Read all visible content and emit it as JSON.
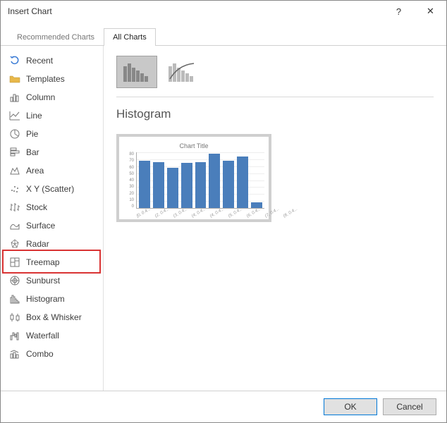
{
  "window": {
    "title": "Insert Chart",
    "help_label": "?",
    "close_label": "✕"
  },
  "tabs": [
    {
      "label": "Recommended Charts",
      "active": false
    },
    {
      "label": "All Charts",
      "active": true
    }
  ],
  "sidebar": {
    "items": [
      {
        "label": "Recent",
        "icon": "undo-icon"
      },
      {
        "label": "Templates",
        "icon": "folder-icon"
      },
      {
        "label": "Column",
        "icon": "column-icon"
      },
      {
        "label": "Line",
        "icon": "line-icon"
      },
      {
        "label": "Pie",
        "icon": "pie-icon"
      },
      {
        "label": "Bar",
        "icon": "bar-icon"
      },
      {
        "label": "Area",
        "icon": "area-icon"
      },
      {
        "label": "X Y (Scatter)",
        "icon": "scatter-icon"
      },
      {
        "label": "Stock",
        "icon": "stock-icon"
      },
      {
        "label": "Surface",
        "icon": "surface-icon"
      },
      {
        "label": "Radar",
        "icon": "radar-icon"
      },
      {
        "label": "Treemap",
        "icon": "treemap-icon"
      },
      {
        "label": "Sunburst",
        "icon": "sunburst-icon"
      },
      {
        "label": "Histogram",
        "icon": "histogram-icon"
      },
      {
        "label": "Box & Whisker",
        "icon": "boxwhisker-icon"
      },
      {
        "label": "Waterfall",
        "icon": "waterfall-icon"
      },
      {
        "label": "Combo",
        "icon": "combo-icon"
      }
    ],
    "selected": "Histogram"
  },
  "main": {
    "subtypes": [
      {
        "name": "histogram",
        "selected": true
      },
      {
        "name": "pareto",
        "selected": false
      }
    ],
    "section_title": "Histogram"
  },
  "chart_data": {
    "type": "bar",
    "title": "Chart Title",
    "categories": [
      "[0, 0.4...",
      "(2, 0.4...",
      "(3, 0.4...",
      "(4, 0.4...",
      "(4, 0.4...",
      "(5, 0.4...",
      "(6, 0.4...",
      "(7, 0.4...",
      "(8, 0.4..."
    ],
    "values": [
      68,
      66,
      58,
      65,
      66,
      78,
      68,
      74,
      8
    ],
    "ylim": [
      0,
      80
    ],
    "yticks": [
      0,
      10,
      20,
      30,
      40,
      50,
      60,
      70,
      80
    ],
    "xlabel": "",
    "ylabel": ""
  },
  "footer": {
    "ok": "OK",
    "cancel": "Cancel"
  }
}
